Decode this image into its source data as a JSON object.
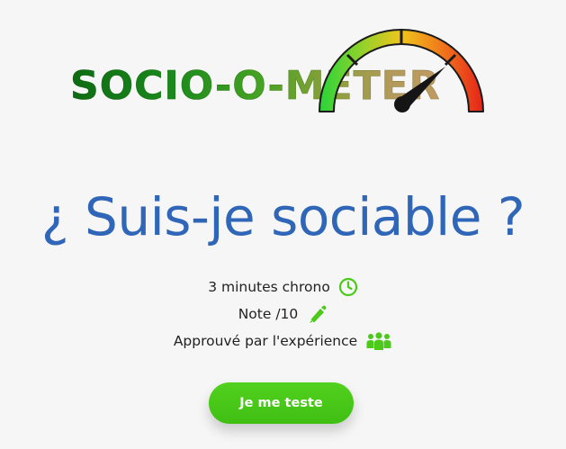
{
  "logo": {
    "text": "SOCIO-O-METER"
  },
  "main": {
    "title": "¿ Suis-je sociable ?",
    "features": [
      {
        "label": "3 minutes chrono",
        "icon": "clock-icon"
      },
      {
        "label": "Note /10",
        "icon": "pen-icon"
      },
      {
        "label": "Approuvé par l'expérience",
        "icon": "users-icon"
      }
    ],
    "cta_label": "Je me teste"
  },
  "colors": {
    "title": "#2f66b8",
    "accent_green": "#4cc91a",
    "logo_dark_green": "#0d6b12"
  }
}
